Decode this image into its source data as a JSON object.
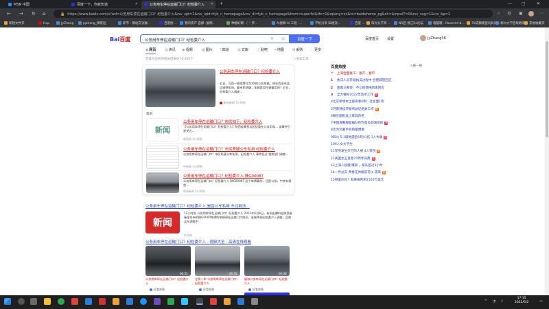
{
  "tabs": [
    {
      "title": "MSN 中国",
      "active": false
    },
    {
      "title": "百度一下，你就知道",
      "active": false
    },
    {
      "title": "公务用车停在运输门口？纪检委介入",
      "active": true
    }
  ],
  "address": "https://www.baidu.com/s?wd=公务用车停在运输门口？纪检委介入&rsv_spt=1&rsv_iqid=fyb_n_homepage&rsv_dl=fyb_n_homepage&from=superfst&tfc=1&rqlang=cn&tn=baiduhome_pg&ch=&inputT=0&rsv_sug=1&rsv_bp=1",
  "bookmarks": [
    "新建文件夹",
    "Hup",
    "JyZhang",
    "pjzhang_博客园",
    "新节 - 网站交流群...",
    "百度搜 ...",
    "我的资产 自媒 -复制...",
    "种植好网 （ '- 罗..",
    "AI搜哪 AI 工程 -...",
    "学机分享 知视流...",
    "百度 ...",
    "阳光分子目 -..",
    "N5区-浙江Ex论坛",
    "电脑哪 - Powered b...",
    "78成都模型问具问...",
    "郑州大学后续教育...",
    "其他收藏夹"
  ],
  "search": {
    "logo_bai": "Bai",
    "logo_du": "百度",
    "query": "公务用车停在运输门口？纪检委介入",
    "button": "百度一下",
    "top_links": [
      "百度首页",
      "设置"
    ],
    "user": "JyZhang36"
  },
  "nav_tabs": [
    "网页",
    "资讯",
    "视频",
    "图片",
    "知道",
    "文库",
    "贴吧",
    "地图",
    "采购",
    "更多"
  ],
  "result_count": "百度为您找到相关结果约76,300个",
  "search_tools": "搜索工具",
  "news_card": {
    "top_title": "公务用车停在运输门口？纪检委介入",
    "top_text": "近日，河西一辆车牌号为XX的公务车辆，停在西安市某运输停车场。着市民质疑，车辆是用作做着用途？近日，纪检委介入调查...",
    "top_source": "新浪新闻",
    "top_time": "5小时前",
    "summary_label": "资讯",
    "items": [
      {
        "title": "公务用车停在运输门口？市民拍下，纪检委介入",
        "text": "【公务用车停在运输门口？纪检委介入】陕西省秦皇岛区纪委在公务用车... 该事件引发关注...",
        "source": "新民网",
        "time": "3小时前"
      },
      {
        "title": "公务用车停在运输门口？市民质疑公车私用 纪检委介入",
        "text": "公务用车停在运输门口？市民质疑公车私用，纪检委介入 事件经过 相关部门调查...",
        "source": "中新网",
        "time": "1小时前"
      },
      {
        "title": "公务用车停在运输门口？纪检委介入 陕G00087",
        "text": "公务用车停在运输门口？纪检委介入 陕G00087 这个车牌真的，还是公务，中央有规定...",
        "source": "网易新闻",
        "time": "5小时前"
      }
    ]
  },
  "result2": {
    "title": "公务用车停在运输门口？纪检委介入,是否公车私用 东北网法...",
    "text": "12小时前 公务用车停在运输门口？纪检委介入 2022年6月8日，有网友爆料在陕西省秦皇岛市的陕G0000车牌的车辆停在运输门口附近，该事件经纪检委介入调查，目前正在调查中...",
    "source": "东北网"
  },
  "result3": {
    "title": "公务用车停在运输门口？纪检委介入 - 视频大全 - 高清在线观看",
    "videos": [
      {
        "cap": "公务用车停在运输门口？纪检委介入",
        "src": "好看视频",
        "dur": "00:55"
      },
      {
        "cap": "全警一车 公务用车停在运输门口？纪检委介入",
        "src": "好看视频",
        "dur": "00:35"
      },
      {
        "cap": "疑似公务车停在运输门口？纪检委介入",
        "src": "好看视频",
        "dur": "00:38"
      }
    ]
  },
  "hot": {
    "title": "百度热搜",
    "refresh": "换一换",
    "items": [
      {
        "text": "上海全面复工、复产、复市",
        "num": "",
        "badge": ""
      },
      {
        "text": "执法人员开展执法过程中 合肥城管回应",
        "num": "1",
        "badge": ""
      },
      {
        "text": "国家三部委：不让疫情拖跨再回应",
        "num": "2",
        "badge": ""
      },
      {
        "text": "全力做好2022年高考工作",
        "num": "3",
        "badge": "热"
      },
      {
        "text": "北京新增本土感染者6例：社会面1例",
        "num": "4",
        "badge": ""
      },
      {
        "text": "河南持续开展驾驶证相关工作",
        "num": "5",
        "badge": "新"
      },
      {
        "text": "联合国批准土耳其改名",
        "num": "6",
        "badge": ""
      },
      {
        "text": "中国海警舰艇编队在钓鱼岛领海巡航",
        "num": "7",
        "badge": "热"
      },
      {
        "text": "华为鸿蒙手机销量爆增",
        "num": "8",
        "badge": ""
      },
      {
        "text": "四川 5.1级地震后5死41伤 1人失联",
        "num": "9",
        "badge": "热"
      },
      {
        "text": "6人女大学生",
        "num": "10",
        "badge": ""
      },
      {
        "text": "东莞发生外万的人被 4人受伤",
        "num": "11",
        "badge": "新"
      },
      {
        "text": "英国女王登基70周年庆典",
        "num": "12",
        "badge": "热"
      },
      {
        "text": "上海人核酸'爆表'，排队超过3小时",
        "num": "13",
        "badge": ""
      },
      {
        "text": "一件过去 青春在你眼前可以 再来",
        "num": "14",
        "badge": "新"
      },
      {
        "text": "哪里危险？就要被判刑1500万美元",
        "num": "15",
        "badge": ""
      }
    ]
  },
  "clock": {
    "time": "17:15",
    "date": "2022/6/2"
  }
}
